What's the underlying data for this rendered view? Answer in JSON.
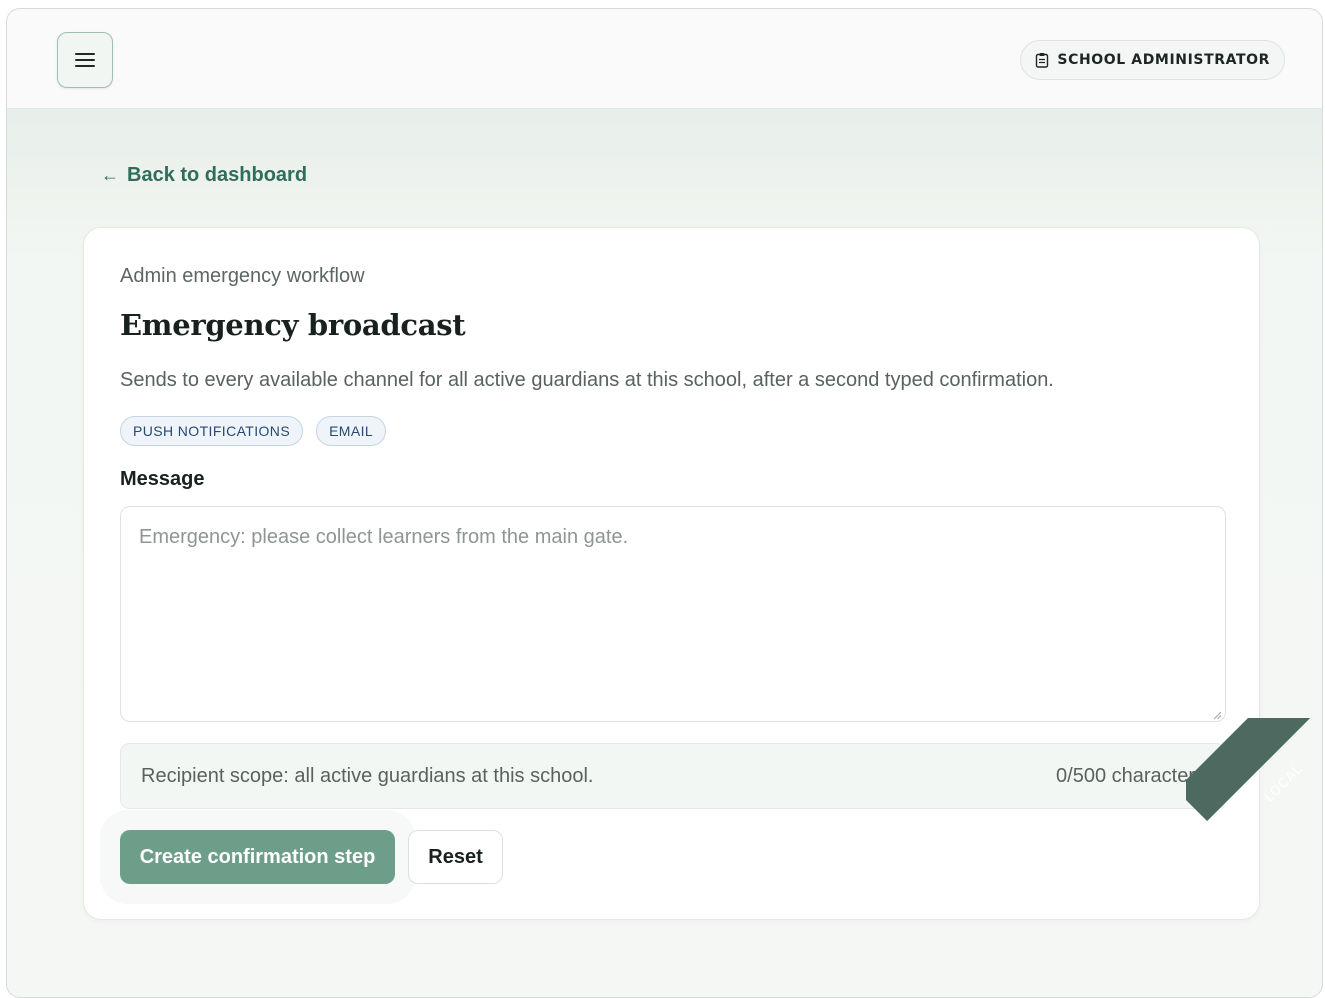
{
  "header": {
    "menu_icon": "hamburger-icon",
    "role_icon": "clipboard-icon",
    "role_label": "SCHOOL ADMINISTRATOR"
  },
  "nav": {
    "back_arrow": "←",
    "back_label": "Back to dashboard"
  },
  "card": {
    "eyebrow": "Admin emergency workflow",
    "title": "Emergency broadcast",
    "description": "Sends to every available channel for all active guardians at this school, after a second typed confirmation.",
    "channels": [
      "PUSH NOTIFICATIONS",
      "EMAIL"
    ],
    "message_label": "Message",
    "message_value": "",
    "message_placeholder": "Emergency: please collect learners from the main gate.",
    "scope_text": "Recipient scope: all active guardians at this school.",
    "char_count": "0/500 characters",
    "primary_button": "Create confirmation step",
    "secondary_button": "Reset"
  },
  "env_badge": "LOCAL",
  "colors": {
    "accent": "#2f6e5a",
    "primary_button": "#6c9e8a",
    "chip_text": "#274a73",
    "ribbon": "#4d6a61"
  }
}
